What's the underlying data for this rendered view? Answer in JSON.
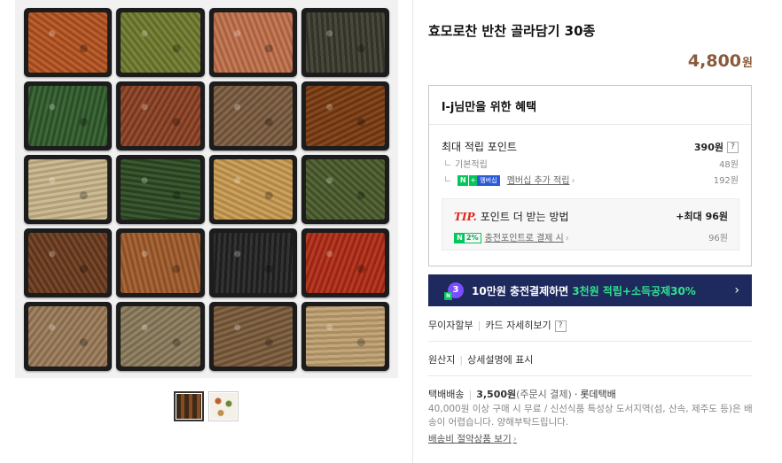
{
  "product": {
    "title": "효모로찬 반찬 골라담기 30종",
    "price": "4,800",
    "price_unit": "원"
  },
  "benefit": {
    "header": "l-j님만을 위한 혜택",
    "max_points_label": "최대 적립 포인트",
    "max_points_value": "390원",
    "help_glyph": "?",
    "basic_label": "기본적립",
    "basic_value": "48원",
    "npay_n": "N",
    "npay_plus": "+",
    "npay_mem": "멤버십",
    "membership_label": "멤버십 추가 적립",
    "membership_value": "192원",
    "tip_mark": "TIP.",
    "tip_title": "포인트 더 받는 방법",
    "tip_max": "+최대 96원",
    "tip_pct": "2%",
    "tip_sub_label": "충전포인트로 결제 시",
    "tip_sub_value": "96원"
  },
  "banner": {
    "badge": "3",
    "text_a": "10만원 충전결제하면",
    "text_b": "3천원 적립+소득공제30%",
    "arrow": "›"
  },
  "installment": {
    "label": "무이자할부",
    "card_link": "카드 자세히보기",
    "help_glyph": "?"
  },
  "origin": {
    "label": "원산지",
    "value": "상세설명에 표시"
  },
  "shipping": {
    "type": "택배배송",
    "fee": "3,500원",
    "fee_note": "(주문시 결제)",
    "carrier": "롯데택배",
    "desc": "40,000원 이상 구매 시 무료 / 신선식품 특성상 도서지역(섬, 산속, 제주도 등)은 배송이 어렵습니다. 양해부탁드립니다.",
    "link": "배송비 절약상품 보기"
  },
  "colors": {
    "price": "#8a5a3c",
    "banner_bg": "#1e2a5e",
    "banner_highlight": "#2fe38c",
    "naver_green": "#03c75a",
    "tip_red": "#e0261b"
  },
  "image": {
    "dish_colors": [
      "#b4521f",
      "#6f7a2c",
      "#c0704a",
      "#3a3a2c",
      "#2f5a2a",
      "#8a3f22",
      "#7a5a3e",
      "#7a3a10",
      "#c8b58a",
      "#2c4a22",
      "#c89a50",
      "#4a5a2a",
      "#6a3a1c",
      "#a05a2a",
      "#222222",
      "#b02a14",
      "#9a7a58",
      "#8a7a5a",
      "#7a5a3a",
      "#bfa070"
    ]
  }
}
